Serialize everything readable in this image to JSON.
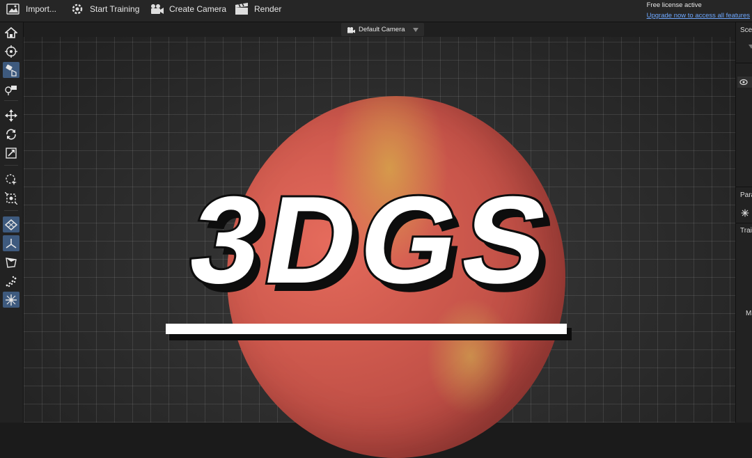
{
  "toolbar": {
    "import_label": "Import...",
    "start_training_label": "Start Training",
    "create_camera_label": "Create Camera",
    "render_label": "Render"
  },
  "license": {
    "status": "Free license active",
    "upgrade_link": "Upgrade now to access all features"
  },
  "viewport": {
    "camera_name": "Default Camera"
  },
  "right_panel": {
    "label_scene": "Sce",
    "label_params": "Para",
    "label_training": "Trai",
    "label_m": "Ma"
  },
  "overlay": {
    "title": "3DGS"
  },
  "colors": {
    "toolbar_bg": "#262626",
    "active_tool": "#3e5a7e",
    "link": "#6ea8ff"
  }
}
